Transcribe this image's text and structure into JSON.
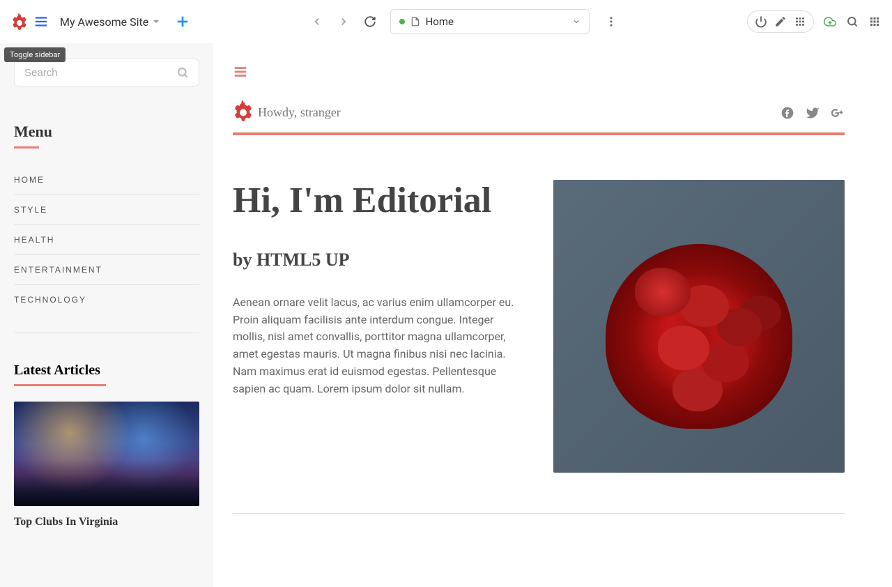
{
  "toolbar": {
    "site_title": "My Awesome Site",
    "url_bar_label": "Home",
    "tooltip": "Toggle sidebar"
  },
  "sidebar": {
    "search_placeholder": "Search",
    "menu_title": "Menu",
    "menu_items": [
      "HOME",
      "STYLE",
      "HEALTH",
      "ENTERTAINMENT",
      "TECHNOLOGY"
    ],
    "latest_title": "Latest Articles",
    "latest_article_title": "Top Clubs In Virginia"
  },
  "content": {
    "greeting": "Howdy, stranger",
    "hero_title": "Hi, I'm Editorial",
    "hero_subtitle": "by HTML5 UP",
    "hero_text": "Aenean ornare velit lacus, ac varius enim ullamcorper eu. Proin aliquam facilisis ante interdum congue. Integer mollis, nisl amet convallis, porttitor magna ullamcorper, amet egestas mauris. Ut magna finibus nisi nec lacinia. Nam maximus erat id euismod egestas. Pellentesque sapien ac quam. Lorem ipsum dolor sit nullam."
  }
}
